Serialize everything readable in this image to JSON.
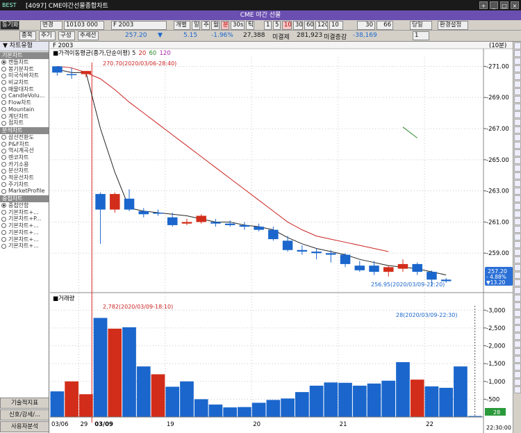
{
  "window": {
    "logo": "BEST",
    "title": "[4097] CME야간선물종합차트",
    "subtitle": "CME 야간 선물",
    "controls": [
      "+",
      "_",
      "□",
      "×"
    ]
  },
  "toolbar": {
    "menu_btn": "동기화",
    "change_btn": "변경",
    "code": "10103 000",
    "product": "F 2003",
    "tabs": [
      "개별",
      "일",
      "주",
      "월",
      "분",
      "30s",
      "틱"
    ],
    "selected_tab": "분",
    "intervals": [
      "1",
      "5",
      "10",
      "30",
      "60",
      "120"
    ],
    "selected_interval": "10",
    "interval_value": "10",
    "count": "30",
    "count2": "66",
    "today_label": "당일",
    "settings_btn": "환경설정"
  },
  "toolbar2": {
    "tabs": [
      "종목",
      "주기",
      "구성",
      "추세선"
    ],
    "price": "257.20",
    "arrow": "▼",
    "change": "5.15",
    "rate": "-1.96%",
    "volume": "27,388",
    "oi_label": "미결제",
    "oi": "281,923",
    "oi_change_label": "미결증감",
    "oi_change": "-38,169",
    "page_value": "1"
  },
  "sidebar": {
    "header": "차트유형",
    "sections": [
      {
        "title": "기본차트",
        "items": [
          "캔들차트",
          "봉기분차트",
          "미국식바차트",
          "비교차트",
          "매물대차트",
          "CandleVolu...",
          "Flow차트",
          "Mountain",
          "계단차트",
          "점차트"
        ],
        "selected": 0
      },
      {
        "title": "분석차트",
        "items": [
          "삼선전환도",
          "P&F차트",
          "역시계곡선",
          "렌코차트",
          "카기소용",
          "분산차트",
          "적운선차트",
          "주기차트",
          "MarketProfile"
        ],
        "selected": -1
      },
      {
        "title": "중첩차트",
        "items": [
          "중첩안함",
          "기본차트+...",
          "기본차트+P...",
          "기본차트+...",
          "기본차트+...",
          "기본차트+...",
          "기본차트+..."
        ],
        "selected": 0
      }
    ],
    "buttons": [
      "기술적지표",
      "신호/강세/...",
      "사용자분석"
    ]
  },
  "chart_header": {
    "title": "F 2003",
    "period": "(10분)",
    "ma_label": "가격이동평균(종가,단순이평)",
    "ma_periods": [
      "5",
      "20",
      "60",
      "120"
    ],
    "ma_colors": [
      "#222222",
      "#cc2222",
      "#2a8a2a",
      "#aa22aa"
    ]
  },
  "chart_data": {
    "type": "candlestick",
    "title": "F 2003",
    "price_axis": {
      "ylim": [
        256.6,
        271.6
      ],
      "ticks": [
        259,
        261,
        263,
        265,
        267,
        269,
        271
      ]
    },
    "candles": [
      {
        "o": 271.0,
        "h": 271.0,
        "l": 270.4,
        "c": 270.6,
        "dir": "down"
      },
      {
        "o": 270.5,
        "h": 270.9,
        "l": 270.2,
        "c": 270.5,
        "dir": "down"
      },
      {
        "o": 270.7,
        "h": 270.7,
        "l": 270.3,
        "c": 270.5,
        "dir": "up"
      },
      {
        "o": 262.8,
        "h": 262.9,
        "l": 259.6,
        "c": 261.8,
        "dir": "down"
      },
      {
        "o": 261.8,
        "h": 262.9,
        "l": 261.6,
        "c": 262.8,
        "dir": "up"
      },
      {
        "o": 262.5,
        "h": 263.1,
        "l": 261.7,
        "c": 261.8,
        "dir": "down"
      },
      {
        "o": 261.7,
        "h": 261.9,
        "l": 261.3,
        "c": 261.5,
        "dir": "down"
      },
      {
        "o": 261.6,
        "h": 261.8,
        "l": 261.4,
        "c": 261.6,
        "dir": "down"
      },
      {
        "o": 261.3,
        "h": 261.6,
        "l": 260.7,
        "c": 260.8,
        "dir": "down"
      },
      {
        "o": 260.9,
        "h": 261.2,
        "l": 260.8,
        "c": 261.0,
        "dir": "up"
      },
      {
        "o": 261.0,
        "h": 261.5,
        "l": 260.9,
        "c": 261.4,
        "dir": "up"
      },
      {
        "o": 261.0,
        "h": 261.2,
        "l": 260.7,
        "c": 260.9,
        "dir": "down"
      },
      {
        "o": 260.9,
        "h": 261.1,
        "l": 260.7,
        "c": 260.8,
        "dir": "down"
      },
      {
        "o": 260.8,
        "h": 261.0,
        "l": 260.5,
        "c": 260.7,
        "dir": "down"
      },
      {
        "o": 260.7,
        "h": 260.9,
        "l": 260.4,
        "c": 260.5,
        "dir": "down"
      },
      {
        "o": 260.5,
        "h": 260.7,
        "l": 259.8,
        "c": 259.9,
        "dir": "down"
      },
      {
        "o": 259.8,
        "h": 260.1,
        "l": 259.1,
        "c": 259.2,
        "dir": "down"
      },
      {
        "o": 259.2,
        "h": 259.5,
        "l": 258.9,
        "c": 259.1,
        "dir": "down"
      },
      {
        "o": 259.1,
        "h": 259.3,
        "l": 258.6,
        "c": 259.0,
        "dir": "down"
      },
      {
        "o": 259.0,
        "h": 259.2,
        "l": 258.4,
        "c": 258.9,
        "dir": "down"
      },
      {
        "o": 258.9,
        "h": 259.0,
        "l": 258.1,
        "c": 258.3,
        "dir": "down"
      },
      {
        "o": 258.2,
        "h": 258.5,
        "l": 257.8,
        "c": 257.9,
        "dir": "down"
      },
      {
        "o": 258.2,
        "h": 258.5,
        "l": 257.6,
        "c": 257.8,
        "dir": "down"
      },
      {
        "o": 257.8,
        "h": 258.2,
        "l": 257.5,
        "c": 258.1,
        "dir": "up"
      },
      {
        "o": 258.0,
        "h": 258.6,
        "l": 257.8,
        "c": 258.3,
        "dir": "up"
      },
      {
        "o": 258.3,
        "h": 258.4,
        "l": 257.6,
        "c": 257.8,
        "dir": "down"
      },
      {
        "o": 257.8,
        "h": 257.9,
        "l": 256.9,
        "c": 257.3,
        "dir": "down"
      },
      {
        "o": 257.3,
        "h": 257.4,
        "l": 257.1,
        "c": 257.2,
        "dir": "down"
      }
    ],
    "ma5": [
      270.8,
      270.6,
      270.6,
      267.0,
      264.2,
      261.9,
      261.7,
      261.6,
      261.5,
      261.4,
      261.2,
      261.0,
      261.0,
      260.8,
      260.7,
      260.5,
      260.0,
      259.6,
      259.3,
      259.1,
      258.9,
      258.6,
      258.4,
      258.2,
      258.1,
      258.0,
      257.8,
      257.6
    ],
    "ma20": [
      271.0,
      270.9,
      270.6,
      270.2,
      269.5,
      268.7,
      268.0,
      267.3,
      266.6,
      265.9,
      265.2,
      264.5,
      263.8,
      263.1,
      262.4,
      261.7,
      261.0,
      260.5,
      260.1,
      259.9,
      259.7,
      259.5,
      259.3,
      259.1
    ],
    "ma60": [
      267.1,
      266.4
    ],
    "ma60_start_index": 24,
    "annotations": {
      "max": "270.70(2020/03/06-28:40)",
      "min": "256.95(2020/03/09-22:20)",
      "last_price": "257.20",
      "last_rate": "- 4.88%",
      "last_change": "▼13.20"
    },
    "volume_title": "거래량",
    "volume_axis": {
      "ylim": [
        0,
        3200
      ],
      "ticks": [
        3000,
        2500,
        2000,
        1500,
        1000,
        500
      ]
    },
    "volume_values": [
      720,
      1000,
      640,
      2782,
      2480,
      2520,
      1420,
      1200,
      850,
      1000,
      500,
      350,
      270,
      280,
      400,
      480,
      520,
      700,
      880,
      970,
      960,
      880,
      940,
      1020,
      1540,
      1050,
      860,
      820,
      1420,
      28
    ],
    "volume_dirs": [
      "down",
      "up",
      "up",
      "down",
      "up",
      "down",
      "down",
      "up",
      "down",
      "down",
      "down",
      "down",
      "down",
      "down",
      "down",
      "down",
      "down",
      "down",
      "down",
      "down",
      "down",
      "down",
      "down",
      "down",
      "down",
      "up",
      "down",
      "down",
      "down",
      "down"
    ],
    "volume_annotations": {
      "max": "2,782(2020/03/09-18:10)",
      "last": "28(2020/03/09-22:30)",
      "last_value": "28"
    },
    "x_labels": [
      "03/06",
      "29",
      "03/09",
      "19",
      "20",
      "21",
      "22"
    ],
    "x_label_index": [
      0,
      2,
      3,
      8,
      14,
      20,
      26
    ],
    "last_time": "22:30:00",
    "colors": {
      "up": "#d22d1a",
      "down": "#1a66cc",
      "bg": "#ffffff",
      "grid": "#c8c8c8"
    }
  }
}
